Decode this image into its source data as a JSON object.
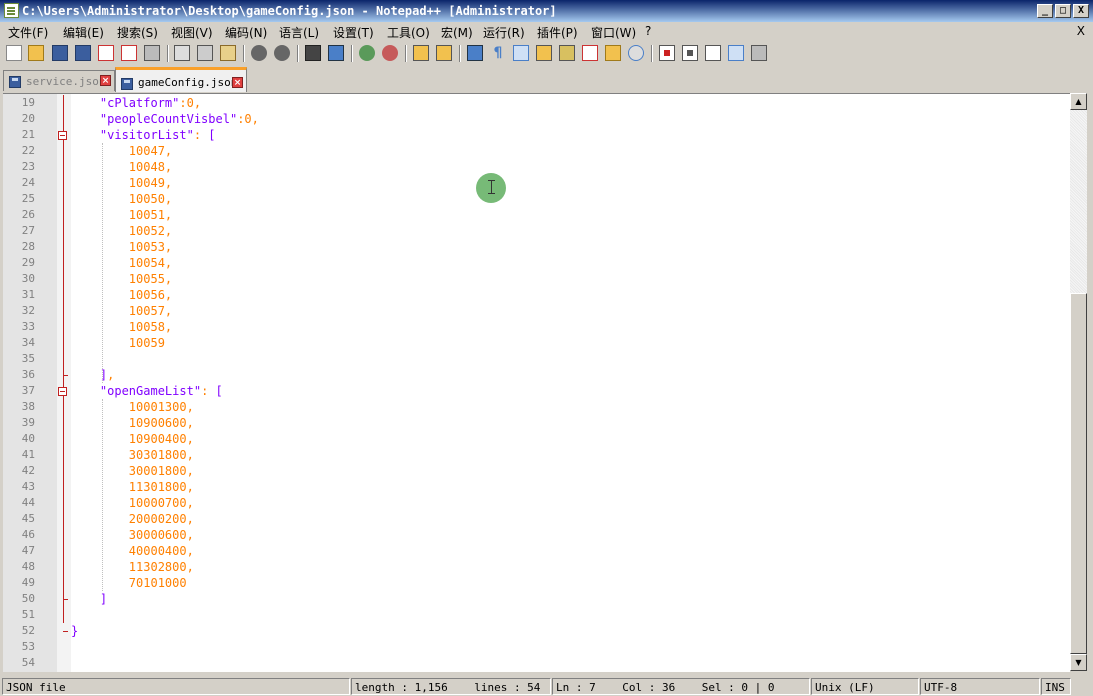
{
  "window": {
    "title": "C:\\Users\\Administrator\\Desktop\\gameConfig.json - Notepad++ [Administrator]",
    "min": "_",
    "max": "□",
    "close": "X"
  },
  "menu": [
    "文件(F)",
    "编辑(E)",
    "搜索(S)",
    "视图(V)",
    "编码(N)",
    "语言(L)",
    "设置(T)",
    "工具(O)",
    "宏(M)",
    "运行(R)",
    "插件(P)",
    "窗口(W)",
    "?"
  ],
  "menu_close": "X",
  "tabs": [
    {
      "label": "service.json",
      "active": false
    },
    {
      "label": "gameConfig.json",
      "active": true
    }
  ],
  "editor": {
    "lines": [
      {
        "n": "19",
        "text": "    \"cPlatform\":0,"
      },
      {
        "n": "20",
        "text": "    \"peopleCountVisbel\":0,"
      },
      {
        "n": "21",
        "text": "    \"visitorList\": ["
      },
      {
        "n": "22",
        "text": "        10047,"
      },
      {
        "n": "23",
        "text": "        10048,"
      },
      {
        "n": "24",
        "text": "        10049,"
      },
      {
        "n": "25",
        "text": "        10050,"
      },
      {
        "n": "26",
        "text": "        10051,"
      },
      {
        "n": "27",
        "text": "        10052,"
      },
      {
        "n": "28",
        "text": "        10053,"
      },
      {
        "n": "29",
        "text": "        10054,"
      },
      {
        "n": "30",
        "text": "        10055,"
      },
      {
        "n": "31",
        "text": "        10056,"
      },
      {
        "n": "32",
        "text": "        10057,"
      },
      {
        "n": "33",
        "text": "        10058,"
      },
      {
        "n": "34",
        "text": "        10059"
      },
      {
        "n": "35",
        "text": ""
      },
      {
        "n": "36",
        "text": "    ],"
      },
      {
        "n": "37",
        "text": "    \"openGameList\": ["
      },
      {
        "n": "38",
        "text": "        10001300,"
      },
      {
        "n": "39",
        "text": "        10900600,"
      },
      {
        "n": "40",
        "text": "        10900400,"
      },
      {
        "n": "41",
        "text": "        30301800,"
      },
      {
        "n": "42",
        "text": "        30001800,"
      },
      {
        "n": "43",
        "text": "        11301800,"
      },
      {
        "n": "44",
        "text": "        10000700,"
      },
      {
        "n": "45",
        "text": "        20000200,"
      },
      {
        "n": "46",
        "text": "        30000600,"
      },
      {
        "n": "47",
        "text": "        40000400,"
      },
      {
        "n": "48",
        "text": "        11302800,"
      },
      {
        "n": "49",
        "text": "        70101000"
      },
      {
        "n": "50",
        "text": "    ]"
      },
      {
        "n": "51",
        "text": ""
      },
      {
        "n": "52",
        "text": "}"
      },
      {
        "n": "53",
        "text": ""
      },
      {
        "n": "54",
        "text": ""
      }
    ]
  },
  "status": {
    "filetype": "JSON file",
    "length": "length : 1,156    lines : 54",
    "position": "Ln : 7    Col : 36    Sel : 0 | 0",
    "eol": "Unix (LF)",
    "encoding": "UTF-8",
    "mode": "INS"
  },
  "colors": {
    "key": "#8000ff",
    "number": "#ff8000",
    "fold": "#c02020",
    "tab_accent": "#f9a02a"
  }
}
